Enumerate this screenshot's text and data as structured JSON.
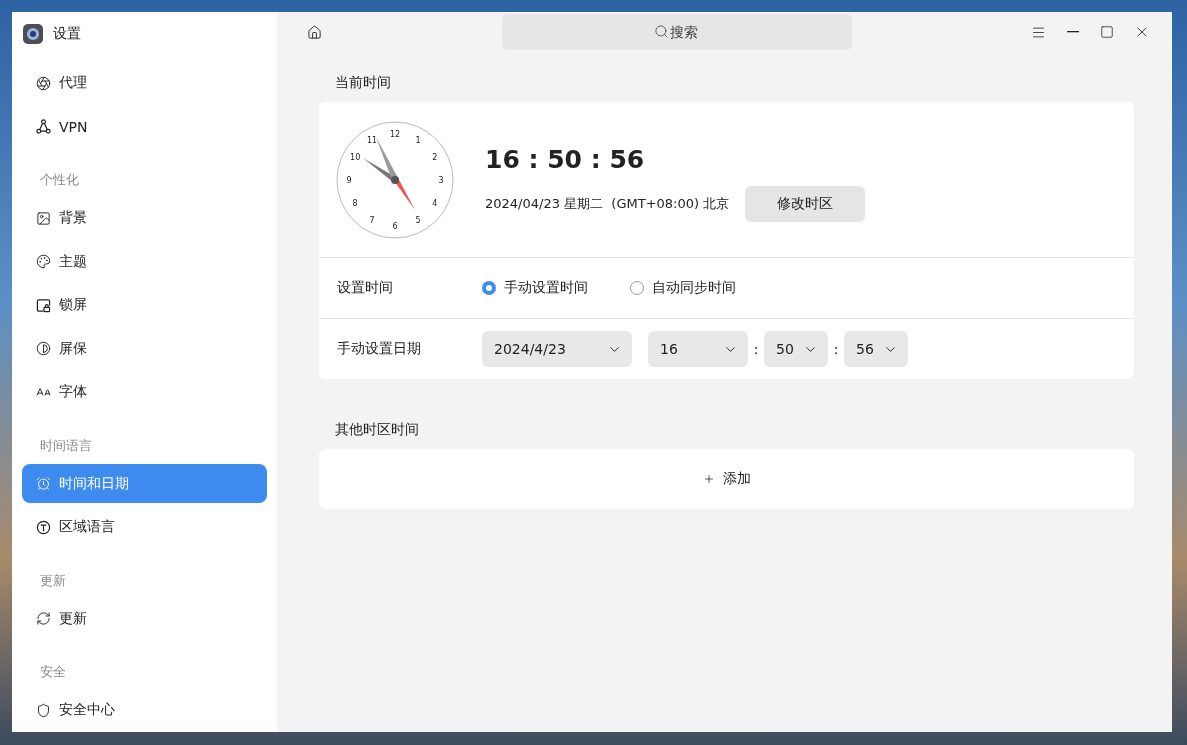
{
  "window": {
    "title": "设置",
    "search": {
      "placeholder": "搜索"
    }
  },
  "sidebar": {
    "groups": [
      {
        "items": [
          {
            "kind": "proxy",
            "label": "代理",
            "selected": false
          },
          {
            "kind": "vpn",
            "label": "VPN",
            "selected": false
          }
        ]
      },
      {
        "heading": "个性化",
        "items": [
          {
            "kind": "image",
            "label": "背景",
            "selected": false
          },
          {
            "kind": "palette",
            "label": "主题",
            "selected": false
          },
          {
            "kind": "lock",
            "label": "锁屏",
            "selected": false
          },
          {
            "kind": "contrast",
            "label": "屏保",
            "selected": false
          },
          {
            "kind": "font",
            "label": "字体",
            "selected": false
          }
        ]
      },
      {
        "heading": "时间语言",
        "items": [
          {
            "kind": "alarm",
            "label": "时间和日期",
            "selected": true
          },
          {
            "kind": "region",
            "label": "区域语言",
            "selected": false
          }
        ]
      },
      {
        "heading": "更新",
        "items": [
          {
            "kind": "refresh",
            "label": "更新",
            "selected": false
          }
        ]
      },
      {
        "heading": "安全",
        "items": [
          {
            "kind": "shield",
            "label": "安全中心",
            "selected": false
          }
        ]
      }
    ]
  },
  "current_time": {
    "heading": "当前时间",
    "clock_numbers": [
      "12",
      "1",
      "2",
      "3",
      "4",
      "5",
      "6",
      "7",
      "8",
      "9",
      "10",
      "11"
    ],
    "time": "16 : 50 : 56",
    "date": "2024/04/23 星期二  (GMT+08:00) 北京",
    "button": "修改时区"
  },
  "set_time": {
    "label": "设置时间",
    "options": [
      {
        "label": "手动设置时间",
        "selected": true
      },
      {
        "label": "自动同步时间",
        "selected": false
      }
    ]
  },
  "manual_date": {
    "label": "手动设置日期",
    "date": "2024/4/23",
    "time_parts": [
      "16",
      "50",
      "56"
    ],
    "separators": [
      ":",
      ":"
    ]
  },
  "other_zones": {
    "heading": "其他时区时间",
    "add": "添加"
  }
}
